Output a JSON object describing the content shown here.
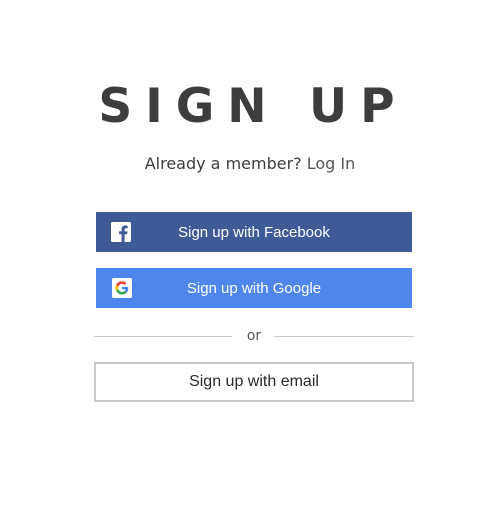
{
  "title": "SIGN UP",
  "subtitle": {
    "text": "Already a member?",
    "login_link": "Log In"
  },
  "buttons": {
    "facebook": {
      "label": "Sign up with Facebook",
      "icon": "facebook-icon",
      "color": "#3e5b98"
    },
    "google": {
      "label": "Sign up with Google",
      "icon": "google-icon",
      "color": "#4f86ec"
    },
    "email": {
      "label": "Sign up with email"
    }
  },
  "divider": {
    "text": "or"
  }
}
